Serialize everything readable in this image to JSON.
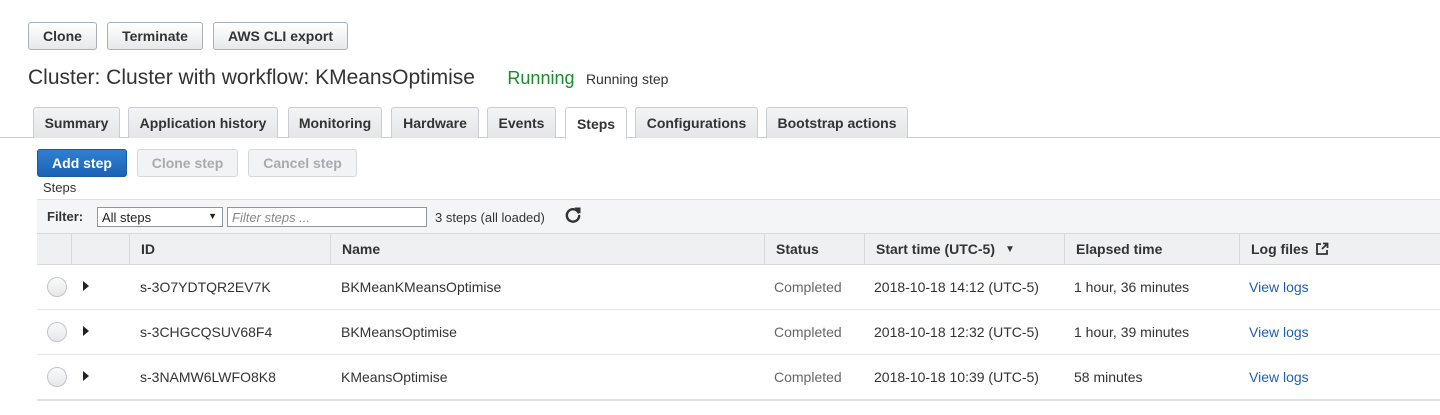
{
  "toolbar": {
    "clone_label": "Clone",
    "terminate_label": "Terminate",
    "cli_export_label": "AWS CLI export"
  },
  "cluster": {
    "title": "Cluster: Cluster with workflow: KMeansOptimise",
    "status": "Running",
    "status_detail": "Running step",
    "status_color": "#1d8a2e"
  },
  "tabs": [
    {
      "label": "Summary"
    },
    {
      "label": "Application history"
    },
    {
      "label": "Monitoring"
    },
    {
      "label": "Hardware"
    },
    {
      "label": "Events"
    },
    {
      "label": "Steps",
      "active": true
    },
    {
      "label": "Configurations"
    },
    {
      "label": "Bootstrap actions"
    }
  ],
  "step_actions": {
    "add_label": "Add step",
    "clone_label": "Clone step",
    "cancel_label": "Cancel step"
  },
  "steps_section_label": "Steps",
  "filter": {
    "label": "Filter:",
    "selected": "All steps",
    "placeholder": "Filter steps ...",
    "count_text": "3 steps (all loaded)"
  },
  "table": {
    "columns": {
      "id": "ID",
      "name": "Name",
      "status": "Status",
      "start_time": "Start time (UTC-5)",
      "elapsed": "Elapsed time",
      "log_files": "Log files"
    },
    "sort": {
      "column": "start_time",
      "direction": "descending"
    },
    "rows": [
      {
        "id": "s-3O7YDTQR2EV7K",
        "name": "BKMeanKMeansOptimise",
        "status": "Completed",
        "start_time": "2018-10-18 14:12 (UTC-5)",
        "elapsed": "1 hour, 36 minutes",
        "log_link": "View logs"
      },
      {
        "id": "s-3CHGCQSUV68F4",
        "name": "BKMeansOptimise",
        "status": "Completed",
        "start_time": "2018-10-18 12:32 (UTC-5)",
        "elapsed": "1 hour, 39 minutes",
        "log_link": "View logs"
      },
      {
        "id": "s-3NAMW6LWFO8K8",
        "name": "KMeansOptimise",
        "status": "Completed",
        "start_time": "2018-10-18 10:39 (UTC-5)",
        "elapsed": "58 minutes",
        "log_link": "View logs"
      }
    ]
  },
  "colors": {
    "accent": "#1c63b4",
    "link": "#1f5fb0",
    "running": "#1d8a2e"
  },
  "icons": {
    "refresh": "refresh-icon",
    "sort": "sort-descending-icon",
    "external_link": "external-link-icon",
    "dropdown": "chevron-down-icon",
    "expand": "caret-right-icon"
  }
}
